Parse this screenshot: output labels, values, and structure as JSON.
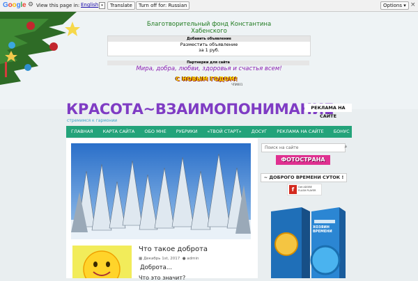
{
  "translate_bar": {
    "view_text": "View this page in:",
    "language": "English",
    "translate_button": "Translate",
    "turn_off_button": "Turn off for: Russian",
    "options_button": "Options ▾",
    "close_label": "×"
  },
  "header": {
    "fund_text": "Благотворительный фонд Константина Хабенского",
    "ad_box": {
      "heading": "Добавить объявление",
      "line1": "Разместить объявление",
      "line2": "за 1 руб."
    },
    "partners": "Партнерки для сайта",
    "wish": "Мира, добра, любви, здоровья и счастья всем!",
    "new_year": "С НОВЫМ ГОДОМ!",
    "new_year_sub": "ЧПИ001",
    "site_title": "КРАСОТА~ВЗАИМОПОНИМАНИЕ",
    "tagline": "стремимся к гармонии",
    "ad_button": "РЕКЛАМА НА САЙТЕ"
  },
  "nav": [
    "ГЛАВНАЯ",
    "КАРТА САЙТА",
    "ОБО МНЕ",
    "РУБРИКИ",
    "«ТВОЙ СТАРТ»",
    "ДОСУГ",
    "РЕКЛАМА НА САЙТЕ",
    "БОНУС"
  ],
  "post": {
    "title": "Что такое доброта",
    "date": "Декабрь 1st, 2017",
    "author": "admin",
    "excerpt": "Доброта...",
    "excerpt2": "Что это значит?"
  },
  "sidebar": {
    "search_placeholder": "Поиск на сайте",
    "fotostrana": "ФОТОСТРАНА",
    "greeting": "~ ДОБРОГО ВРЕМЕНИ СУТОК ! ~",
    "flash_text_1": "Get ADOBE",
    "flash_text_2": "FLASH PLAYER",
    "product_title": "ХОЗЯИН ВРЕМЕНИ"
  },
  "colors": {
    "nav_bg": "#23a37a",
    "title": "#7f3cc4",
    "wish": "#8a1cb0",
    "fund": "#1f7a1f"
  }
}
